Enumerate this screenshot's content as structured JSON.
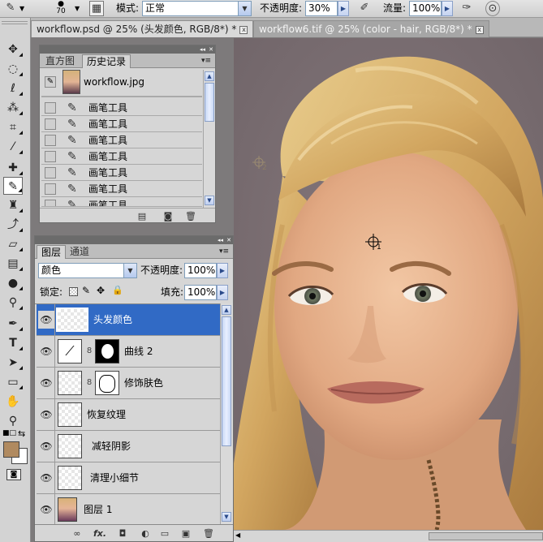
{
  "options_bar": {
    "brush_size": "70",
    "mode_label": "模式:",
    "mode_value": "正常",
    "opacity_label": "不透明度:",
    "opacity_value": "30%",
    "flow_label": "流量:",
    "flow_value": "100%"
  },
  "tabs": [
    {
      "label": "workflow.psd @ 25% (头发颜色, RGB/8*) *",
      "close": "x"
    },
    {
      "label": "workflow6.tif @ 25% (color - hair, RGB/8*) *",
      "close": "x"
    }
  ],
  "history_panel": {
    "tabs": [
      "直方图",
      "历史记录"
    ],
    "snapshot_label": "workflow.jpg",
    "states": [
      "画笔工具",
      "画笔工具",
      "画笔工具",
      "画笔工具",
      "画笔工具",
      "画笔工具",
      "画笔工具"
    ]
  },
  "layers_panel": {
    "tabs": [
      "图层",
      "通道"
    ],
    "blend_mode": "颜色",
    "opacity_label": "不透明度:",
    "opacity_value": "100%",
    "lock_label": "锁定:",
    "fill_label": "填充:",
    "fill_value": "100%",
    "layers": [
      {
        "name": "头发颜色",
        "selected": true
      },
      {
        "name": "曲线 2",
        "selected": false
      },
      {
        "name": "修饰肤色",
        "selected": false
      },
      {
        "name": "恢复纹理",
        "selected": false
      },
      {
        "name": "减轻阴影",
        "selected": false
      },
      {
        "name": "清理小细节",
        "selected": false
      },
      {
        "name": "图层 1",
        "selected": false
      }
    ],
    "footer_icons": [
      "link-icon",
      "fx-icon",
      "mask-icon",
      "adjustment-icon",
      "group-icon",
      "new-layer-icon",
      "trash-icon"
    ],
    "fx_text": "fx."
  },
  "canvas": {
    "point_labels": [
      "1",
      "2"
    ]
  },
  "colors": {
    "foreground": "#b08a60",
    "background": "#ffffff",
    "selection": "#316ac5"
  }
}
